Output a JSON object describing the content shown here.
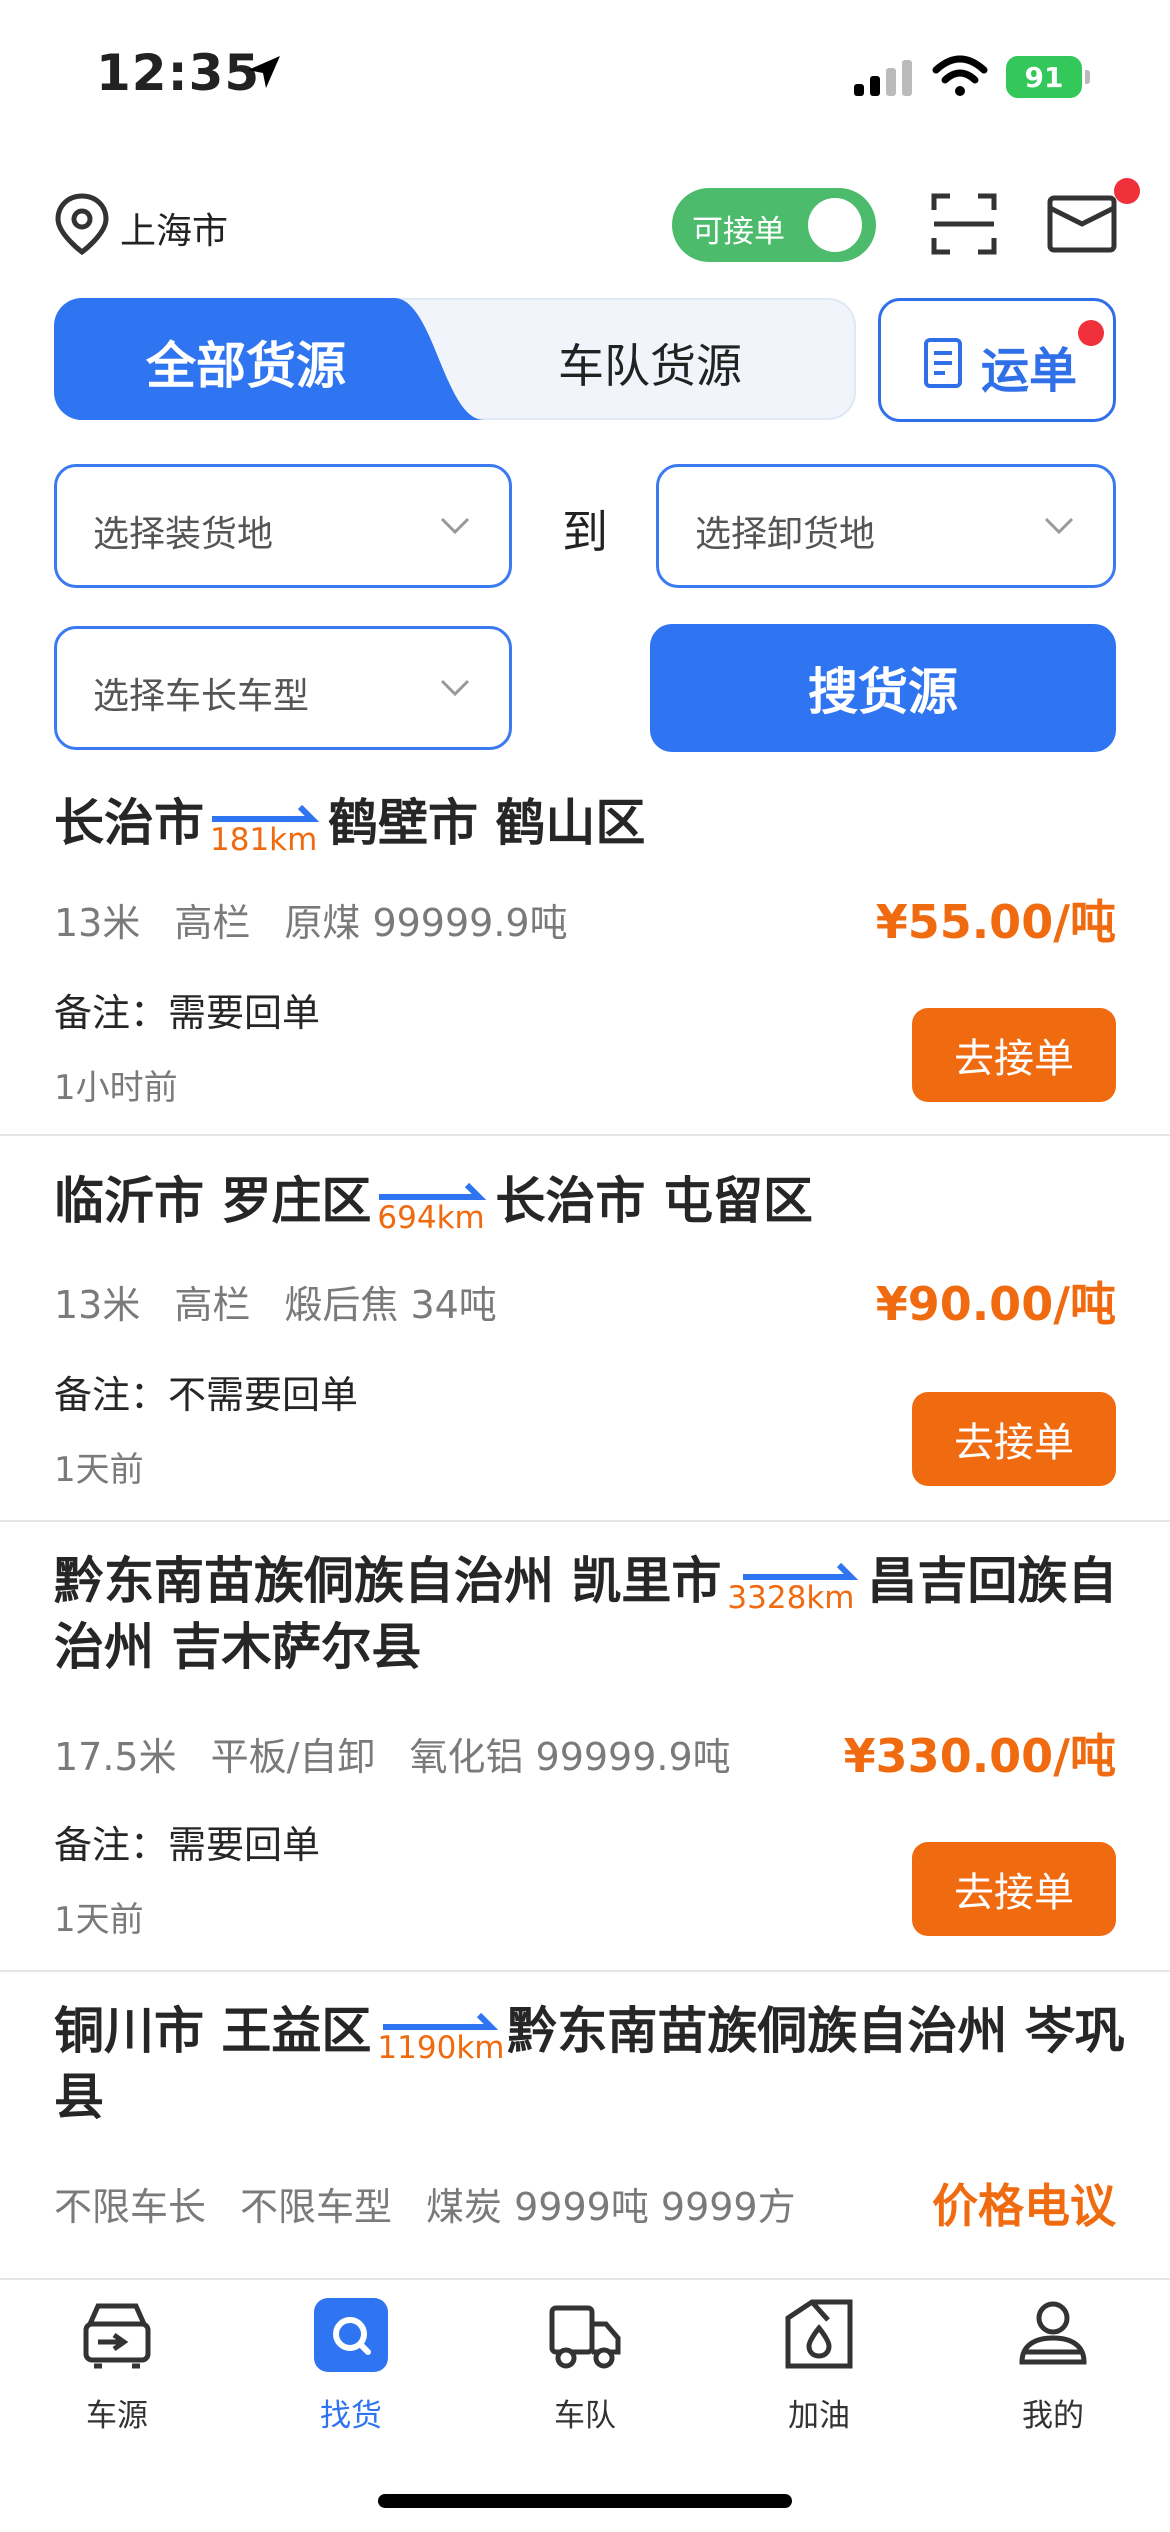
{
  "status_bar": {
    "time": "12:35",
    "battery": "91"
  },
  "header": {
    "city": "上海市",
    "toggle_label": "可接单"
  },
  "tabs": {
    "all": "全部货源",
    "fleet": "车队货源",
    "waybill": "运单"
  },
  "filters": {
    "load_placeholder": "选择装货地",
    "to": "到",
    "unload_placeholder": "选择卸货地",
    "vehicle_placeholder": "选择车长车型",
    "search_button": "搜货源"
  },
  "listings": [
    {
      "from": "长治市",
      "distance": "181km",
      "to": "鹤壁市 鹤山区",
      "length": "13米",
      "vehicle": "高栏",
      "cargo": "原煤 99999.9吨",
      "price": "¥55.00/吨",
      "note": "备注：需要回单",
      "time": "1小时前",
      "action": "去接单"
    },
    {
      "from": "临沂市 罗庄区",
      "distance": "694km",
      "to": "长治市 屯留区",
      "length": "13米",
      "vehicle": "高栏",
      "cargo": "煅后焦 34吨",
      "price": "¥90.00/吨",
      "note": "备注：不需要回单",
      "time": "1天前",
      "action": "去接单"
    },
    {
      "from": "黔东南苗族侗族自治州 凯里市",
      "distance": "3328km",
      "to": "昌吉回族自治州 吉木萨尔县",
      "length": "17.5米",
      "vehicle": "平板/自卸",
      "cargo": "氧化铝 99999.9吨",
      "price": "¥330.00/吨",
      "note": "备注：需要回单",
      "time": "1天前",
      "action": "去接单"
    },
    {
      "from": "铜川市 王益区",
      "distance": "1190km",
      "to": "黔东南苗族侗族自治州 岑巩县",
      "length": "不限车长",
      "vehicle": "不限车型",
      "cargo": "煤炭 9999吨 9999方",
      "price": "价格电议"
    }
  ],
  "nav": [
    {
      "label": "车源",
      "icon": "truck-source-icon"
    },
    {
      "label": "找货",
      "icon": "find-cargo-icon",
      "active": true
    },
    {
      "label": "车队",
      "icon": "fleet-truck-icon"
    },
    {
      "label": "加油",
      "icon": "fuel-icon"
    },
    {
      "label": "我的",
      "icon": "profile-icon"
    }
  ],
  "colors": {
    "primary": "#2f74f0",
    "accent": "#f06a10",
    "toggle": "#4cbb6b",
    "alert": "#f0303a"
  }
}
